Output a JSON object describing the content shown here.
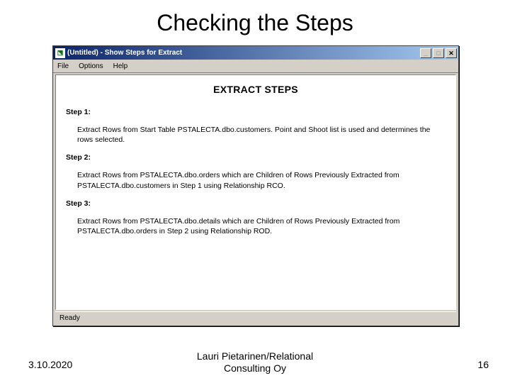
{
  "slide": {
    "title": "Checking the Steps",
    "date": "3.10.2020",
    "author": "Lauri Pietarinen/Relational\nConsulting Oy",
    "page": "16"
  },
  "window": {
    "title": "(Untitled) - Show Steps for Extract",
    "icon_glyph": "⬔",
    "menu": {
      "file": "File",
      "options": "Options",
      "help": "Help"
    },
    "buttons": {
      "min": "_",
      "max": "□",
      "close": "✕"
    },
    "heading": "EXTRACT STEPS",
    "steps": [
      {
        "label": "Step  1:",
        "text": "Extract Rows from Start Table PSTALECTA.dbo.customers. Point and Shoot list is used and determines the rows selected."
      },
      {
        "label": "Step  2:",
        "text": "Extract Rows from PSTALECTA.dbo.orders which are Children of Rows Previously Extracted from PSTALECTA.dbo.customers in Step  1 using Relationship RCO."
      },
      {
        "label": "Step  3:",
        "text": "Extract Rows from PSTALECTA.dbo.details which are Children of Rows Previously Extracted from PSTALECTA.dbo.orders in Step  2 using Relationship ROD."
      }
    ],
    "status": "Ready"
  }
}
